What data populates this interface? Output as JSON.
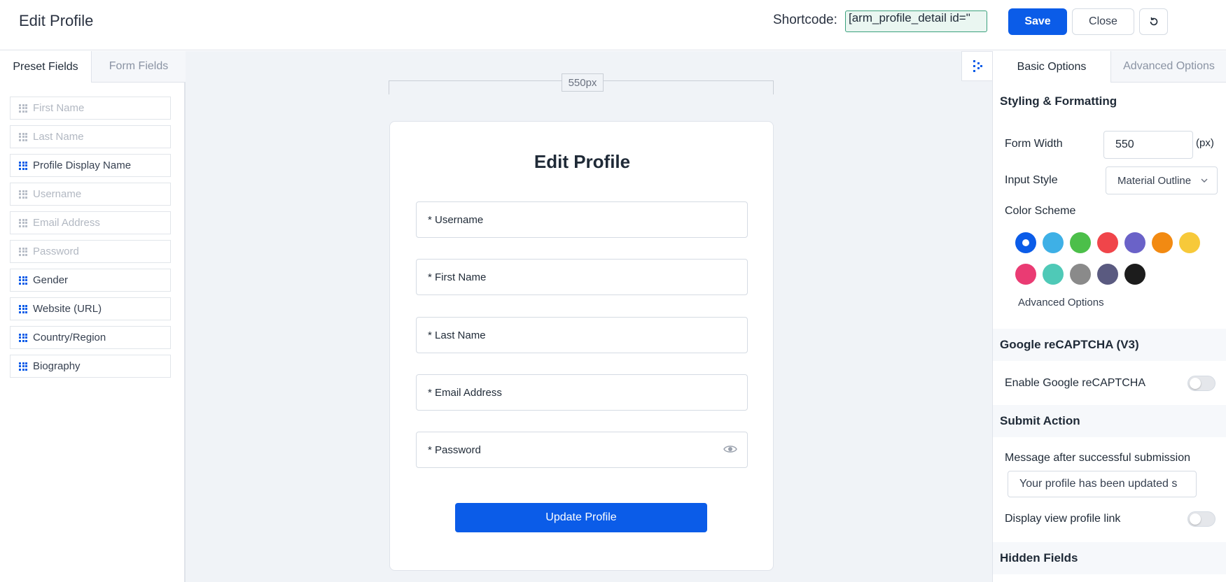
{
  "header": {
    "title": "Edit Profile",
    "shortcode_label": "Shortcode:",
    "shortcode_value": "[arm_profile_detail id=\"",
    "save_label": "Save",
    "close_label": "Close"
  },
  "left_panel": {
    "tabs": [
      {
        "label": "Preset Fields",
        "active": true
      },
      {
        "label": "Form Fields",
        "active": false
      }
    ],
    "fields": [
      {
        "label": "First Name",
        "state": "disabled"
      },
      {
        "label": "Last Name",
        "state": "disabled"
      },
      {
        "label": "Profile Display Name",
        "state": "active"
      },
      {
        "label": "Username",
        "state": "disabled"
      },
      {
        "label": "Email Address",
        "state": "disabled"
      },
      {
        "label": "Password",
        "state": "disabled"
      },
      {
        "label": "Gender",
        "state": "active"
      },
      {
        "label": "Website (URL)",
        "state": "active"
      },
      {
        "label": "Country/Region",
        "state": "active"
      },
      {
        "label": "Biography",
        "state": "active"
      }
    ]
  },
  "canvas": {
    "width_label": "550px",
    "form_title": "Edit Profile",
    "fields": [
      "* Username",
      "* First Name",
      "* Last Name",
      "* Email Address",
      "* Password"
    ],
    "submit_label": "Update Profile"
  },
  "right_panel": {
    "tabs": [
      {
        "label": "Basic Options",
        "active": true
      },
      {
        "label": "Advanced Options",
        "active": false
      }
    ],
    "styling": {
      "heading": "Styling & Formatting",
      "form_width_label": "Form Width",
      "form_width_value": "550",
      "form_width_unit": "(px)",
      "input_style_label": "Input Style",
      "input_style_value": "Material Outline",
      "color_scheme_label": "Color Scheme",
      "colors": [
        "#0b5ce8",
        "#3eb0e6",
        "#4cbf4a",
        "#f0454a",
        "#6a62c8",
        "#f28a12",
        "#f7c93a",
        "#ea3b73",
        "#4fc9b7",
        "#8a8a8a",
        "#5a5a80",
        "#1c1c1c"
      ],
      "selected_color": "#0b5ce8",
      "advanced_link": "Advanced Options"
    },
    "recaptcha": {
      "heading": "Google reCAPTCHA (V3)",
      "enable_label": "Enable Google reCAPTCHA",
      "enabled": false
    },
    "submit_action": {
      "heading": "Submit Action",
      "message_label": "Message after successful submission",
      "message_value": "Your profile has been updated s",
      "view_link_label": "Display view profile link",
      "view_link_enabled": false
    },
    "hidden_fields": {
      "heading": "Hidden Fields"
    }
  }
}
